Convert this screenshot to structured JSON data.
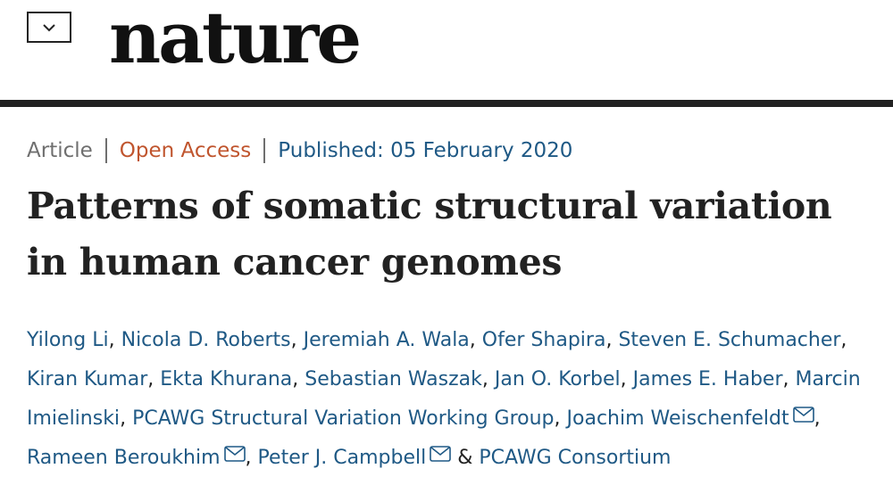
{
  "header": {
    "menu_icon": "chevron-down-icon",
    "logo_text": "nature"
  },
  "article": {
    "type": "Article",
    "access": "Open Access",
    "published": "Published: 05 February 2020",
    "title": "Patterns of somatic structural variation in human cancer genomes",
    "authors": [
      {
        "name": "Yilong Li",
        "sep": ", "
      },
      {
        "name": "Nicola D. Roberts",
        "sep": ", "
      },
      {
        "name": "Jeremiah A. Wala",
        "sep": ", "
      },
      {
        "name": "Ofer Shapira",
        "sep": ", "
      },
      {
        "name": "Steven E. Schumacher",
        "sep": ", "
      },
      {
        "name": "Kiran Kumar",
        "sep": ", "
      },
      {
        "name": "Ekta Khurana",
        "sep": ", "
      },
      {
        "name": "Sebastian Waszak",
        "sep": ", "
      },
      {
        "name": "Jan O. Korbel",
        "sep": ", "
      },
      {
        "name": "James E. Haber",
        "sep": ", "
      },
      {
        "name": "Marcin Imielinski",
        "sep": ", "
      },
      {
        "name": "PCAWG Structural Variation Working Group",
        "sep": ", "
      },
      {
        "name": "Joachim Weischenfeldt",
        "sep": ", ",
        "mail": true
      },
      {
        "name": "Rameen Beroukhim",
        "sep": ", ",
        "mail": true
      },
      {
        "name": "Peter J. Campbell",
        "sep": " & ",
        "mail": true
      },
      {
        "name": "PCAWG Consortium",
        "sep": ""
      }
    ]
  },
  "colors": {
    "link": "#1f5985",
    "open_access": "#c0552e",
    "muted": "#6f6f6f",
    "rule": "#222222"
  }
}
